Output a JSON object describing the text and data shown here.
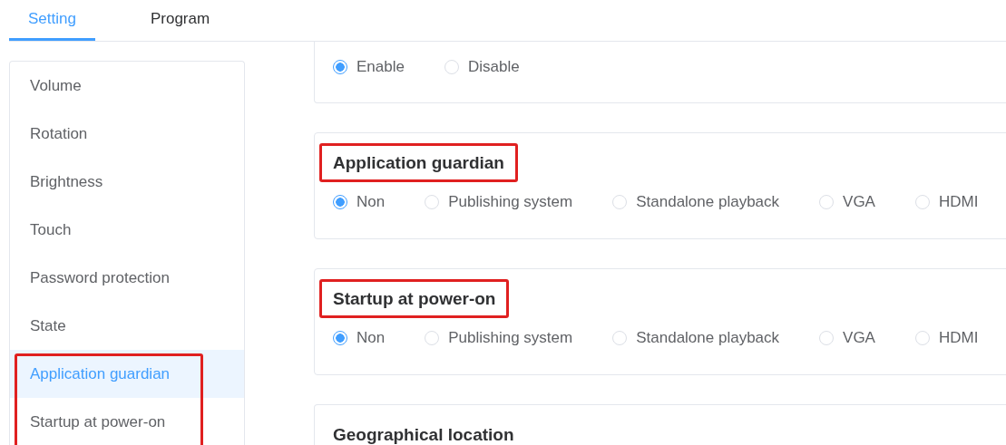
{
  "tabs": [
    {
      "label": "Setting",
      "selected": true
    },
    {
      "label": "Program",
      "selected": false
    }
  ],
  "sidebar": {
    "items": [
      {
        "label": "Volume",
        "selected": false,
        "framed": false
      },
      {
        "label": "Rotation",
        "selected": false,
        "framed": false
      },
      {
        "label": "Brightness",
        "selected": false,
        "framed": false
      },
      {
        "label": "Touch",
        "selected": false,
        "framed": false
      },
      {
        "label": "Password protection",
        "selected": false,
        "framed": false
      },
      {
        "label": "State",
        "selected": false,
        "framed": false
      },
      {
        "label": "Application guardian",
        "selected": true,
        "framed": true
      },
      {
        "label": "Startup at power-on",
        "selected": false,
        "framed": true
      }
    ]
  },
  "sections": [
    {
      "options": [
        {
          "label": "Enable",
          "selected": true
        },
        {
          "label": "Disable",
          "selected": false
        }
      ]
    },
    {
      "title": "Application guardian",
      "framed": true,
      "options": [
        {
          "label": "Non",
          "selected": true
        },
        {
          "label": "Publishing system",
          "selected": false
        },
        {
          "label": "Standalone playback",
          "selected": false
        },
        {
          "label": "VGA",
          "selected": false
        },
        {
          "label": "HDMI",
          "selected": false
        }
      ]
    },
    {
      "title": "Startup at power-on",
      "framed": true,
      "options": [
        {
          "label": "Non",
          "selected": true
        },
        {
          "label": "Publishing system",
          "selected": false
        },
        {
          "label": "Standalone playback",
          "selected": false
        },
        {
          "label": "VGA",
          "selected": false
        },
        {
          "label": "HDMI",
          "selected": false
        }
      ]
    },
    {
      "title": "Geographical location",
      "framed": false
    }
  ]
}
